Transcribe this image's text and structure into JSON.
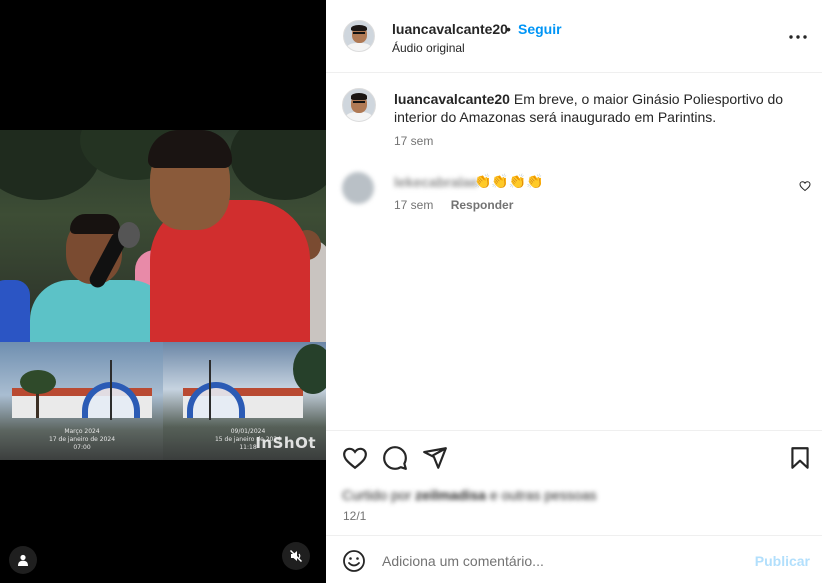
{
  "post": {
    "username": "luancavalcante20",
    "separator": "•",
    "follow_label": "Seguir",
    "audio_label": "Áudio original"
  },
  "caption": {
    "username": "luancavalcante20",
    "text": "Em breve, o maior Ginásio Poliesportivo do interior do Amazonas será inaugurado em Parintins.",
    "time": "17 sem"
  },
  "comment": {
    "username": "lekecabralae",
    "text": "👏👏👏👏",
    "time": "17 sem",
    "reply_label": "Responder"
  },
  "media": {
    "watermark": "InShOt",
    "stamp_left": [
      "Março 2024",
      "17 de janeiro de 2024 07:00"
    ],
    "stamp_right": [
      "09/01/2024",
      "15 de janeiro de 2024 11:18"
    ]
  },
  "footer": {
    "likes_prefix": "Curtido por",
    "likes_user": "zeilmadisa",
    "likes_suffix": "e outras pessoas",
    "date": "12/1"
  },
  "add_comment": {
    "placeholder": "Adiciona um comentário...",
    "publish_label": "Publicar"
  },
  "icons": {
    "more": "more-options-icon",
    "like": "heart-icon",
    "comment": "comment-icon",
    "share": "share-icon",
    "save": "bookmark-icon",
    "emoji": "emoji-icon",
    "mute": "muted-audio-icon",
    "user": "user-icon"
  },
  "colors": {
    "accent": "#0095f6",
    "publish_disabled": "#b2dffc"
  }
}
